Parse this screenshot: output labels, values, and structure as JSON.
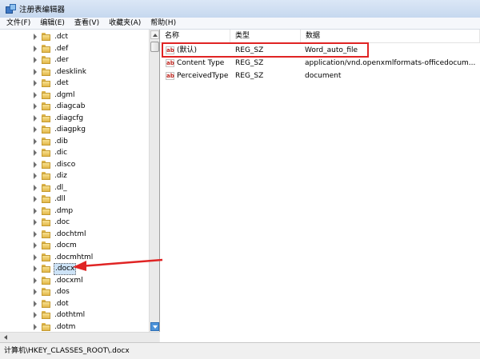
{
  "window": {
    "title": "注册表编辑器"
  },
  "menu": [
    "文件(F)",
    "编辑(E)",
    "查看(V)",
    "收藏夹(A)",
    "帮助(H)"
  ],
  "tree": {
    "items": [
      ".dct",
      ".def",
      ".der",
      ".desklink",
      ".det",
      ".dgml",
      ".diagcab",
      ".diagcfg",
      ".diagpkg",
      ".dib",
      ".dic",
      ".disco",
      ".diz",
      ".dl_",
      ".dll",
      ".dmp",
      ".doc",
      ".dochtml",
      ".docm",
      ".docmhtml",
      ".docx",
      ".docxml",
      ".dos",
      ".dot",
      ".dothtml",
      ".dotm"
    ],
    "selected": ".docx"
  },
  "list": {
    "columns": [
      "名称",
      "类型",
      "数据"
    ],
    "rows": [
      {
        "name": "(默认)",
        "type": "REG_SZ",
        "data": "Word_auto_file"
      },
      {
        "name": "Content Type",
        "type": "REG_SZ",
        "data": "application/vnd.openxmlformats-officedocum..."
      },
      {
        "name": "PerceivedType",
        "type": "REG_SZ",
        "data": "document"
      }
    ],
    "value_icon_text": "ab"
  },
  "status": {
    "path": "计算机\\HKEY_CLASSES_ROOT\\.docx"
  },
  "colors": {
    "annotation": "#e02424",
    "selection": "#cde3f7"
  }
}
